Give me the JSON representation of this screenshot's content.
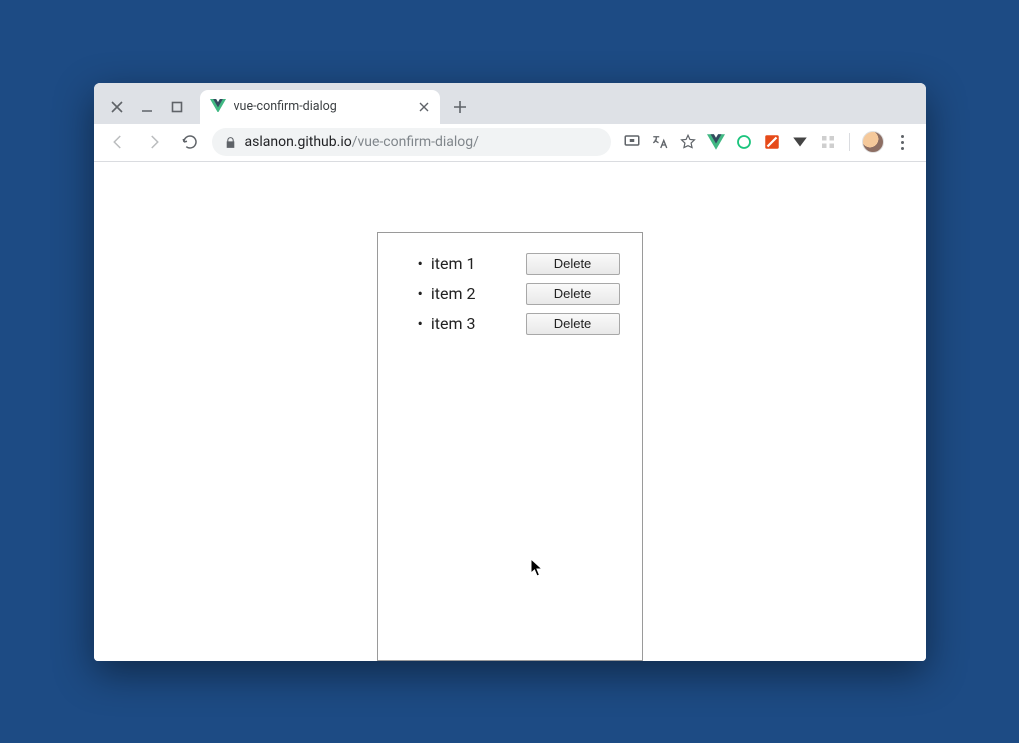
{
  "window": {
    "tab_title": "vue-confirm-dialog",
    "url_host": "aslanon.github.io",
    "url_path": "/vue-confirm-dialog/"
  },
  "panel": {
    "items": [
      {
        "label": "item 1",
        "button": "Delete"
      },
      {
        "label": "item 2",
        "button": "Delete"
      },
      {
        "label": "item 3",
        "button": "Delete"
      }
    ]
  }
}
